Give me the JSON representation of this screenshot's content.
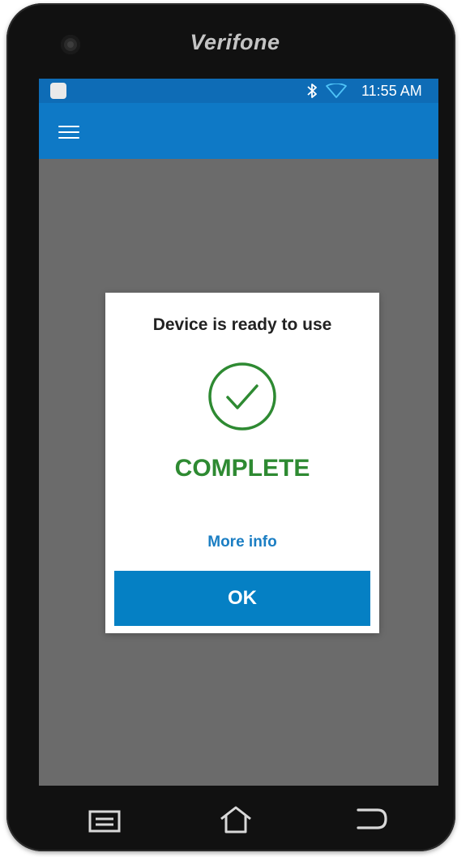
{
  "device": {
    "brand": "Verifone"
  },
  "statusbar": {
    "time": "11:55 AM",
    "icons": [
      "notification-square-icon",
      "bluetooth-icon",
      "wifi-icon"
    ]
  },
  "appbar": {
    "menu_icon": "hamburger-menu-icon"
  },
  "dialog": {
    "title": "Device is ready to use",
    "status_icon": "check-circle-icon",
    "status_text": "COMPLETE",
    "link_label": "More info",
    "ok_label": "OK"
  },
  "navbar": {
    "icons": [
      "recent-apps-icon",
      "home-icon",
      "back-icon"
    ]
  },
  "colors": {
    "appbar": "#0e79c6",
    "statusbar": "#0e6cb6",
    "success": "#2e8a32",
    "link": "#1b7ec3",
    "button": "#0580c4",
    "backdrop": "#6b6b6b"
  }
}
